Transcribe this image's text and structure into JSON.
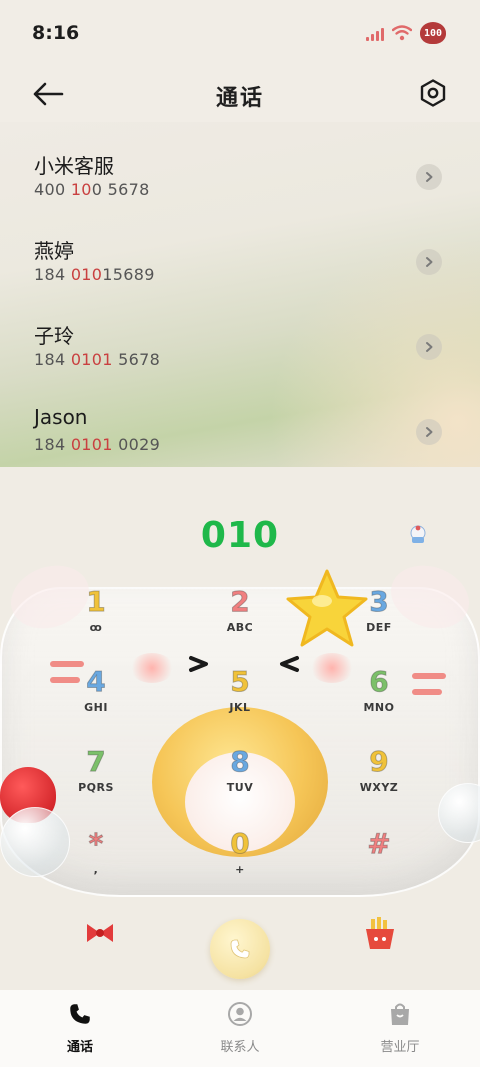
{
  "status_bar": {
    "time": "8:16",
    "battery": "100"
  },
  "header": {
    "title": "通话"
  },
  "contacts": [
    {
      "name": "小米客服",
      "number_parts": [
        {
          "text": "400 ",
          "hl": false
        },
        {
          "text": "10",
          "hl": true
        },
        {
          "text": "0 5678",
          "hl": false
        }
      ]
    },
    {
      "name": "燕婷",
      "number_parts": [
        {
          "text": "184 ",
          "hl": false
        },
        {
          "text": "010",
          "hl": true
        },
        {
          "text": "15689",
          "hl": false
        }
      ]
    },
    {
      "name": "子玲",
      "number_parts": [
        {
          "text": "184 ",
          "hl": false
        },
        {
          "text": "0101",
          "hl": true
        },
        {
          "text": " 5678",
          "hl": false
        }
      ]
    },
    {
      "name": "Jason",
      "number_parts": [
        {
          "text": "184 ",
          "hl": false
        },
        {
          "text": "0101",
          "hl": true
        },
        {
          "text": " 0029",
          "hl": false
        }
      ]
    }
  ],
  "dialer": {
    "input": "010",
    "keys": [
      {
        "digit": "1",
        "letters": "ꝏ",
        "color": "#f0c23a"
      },
      {
        "digit": "2",
        "letters": "ABC",
        "color": "#f08080"
      },
      {
        "digit": "3",
        "letters": "DEF",
        "color": "#6aa8e0"
      },
      {
        "digit": "4",
        "letters": "GHI",
        "color": "#6aa8e0"
      },
      {
        "digit": "5",
        "letters": "JKL",
        "color": "#f0c23a"
      },
      {
        "digit": "6",
        "letters": "MNO",
        "color": "#7cc06a"
      },
      {
        "digit": "7",
        "letters": "PQRS",
        "color": "#7cc06a"
      },
      {
        "digit": "8",
        "letters": "TUV",
        "color": "#6aa8e0"
      },
      {
        "digit": "9",
        "letters": "WXYZ",
        "color": "#f0c23a"
      },
      {
        "digit": "*",
        "letters": ",",
        "color": "#f08080"
      },
      {
        "digit": "0",
        "letters": "+",
        "color": "#f0c23a"
      },
      {
        "digit": "#",
        "letters": "",
        "color": "#f08080"
      }
    ]
  },
  "bottom_nav": [
    {
      "label": "通话",
      "icon": "phone-icon",
      "active": true
    },
    {
      "label": "联系人",
      "icon": "contacts-icon",
      "active": false
    },
    {
      "label": "营业厅",
      "icon": "shopping-bag-icon",
      "active": false
    }
  ],
  "colors": {
    "accent_green": "#1fb84a",
    "highlight_red": "#c94040"
  }
}
